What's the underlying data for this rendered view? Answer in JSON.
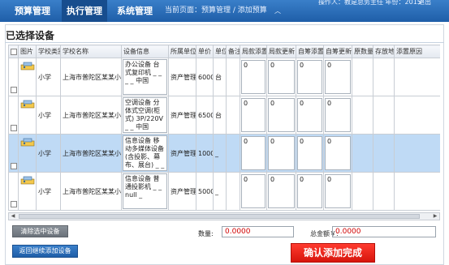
{
  "nav": {
    "items": [
      "预算管理",
      "执行管理",
      "系统管理"
    ],
    "breadcrumb": "当前页面：预算管理 / 添加预算",
    "collapse_icon": "chevron-up-icon",
    "user_info": "操作人：教是总务主任  年份：2015",
    "logout": "退出"
  },
  "page": {
    "title": "已选择设备"
  },
  "table": {
    "columns": [
      "",
      "图片",
      "学校类别",
      "学校名称",
      "设备信息",
      "所属单位",
      "单价",
      "单位",
      "备注",
      "局款添置",
      "局款更新",
      "自筹添置",
      "自筹更新",
      "原数量",
      "存放地",
      "添置原因"
    ],
    "rows": [
      {
        "selected": false,
        "school_type": "小学",
        "school_name": "上海市普陀区某某小学",
        "info": "办公设备 台式复印机 _ _ _ _ 中国",
        "unit_org": "资产管理",
        "price": "6000",
        "unit": "台",
        "note": "",
        "vals": [
          "0",
          "0",
          "0",
          "0"
        ]
      },
      {
        "selected": false,
        "school_type": "小学",
        "school_name": "上海市普陀区某某小学",
        "info": "空调设备 分体式空调(柜式) 3P/220V _ _ 中国",
        "unit_org": "资产管理",
        "price": "6500",
        "unit": "台",
        "note": "",
        "vals": [
          "0",
          "0",
          "0",
          "0"
        ]
      },
      {
        "selected": true,
        "school_type": "小学",
        "school_name": "上海市普陀区某某小学",
        "info": "信息设备 移动多媒体设备(含投影、幕布、展台) _ _ null _",
        "unit_org": "资产管理",
        "price": "1000",
        "unit": "_",
        "note": "",
        "vals": [
          "0",
          "0",
          "0",
          "0"
        ]
      },
      {
        "selected": false,
        "school_type": "小学",
        "school_name": "上海市普陀区某某小学",
        "info": "信息设备 普通投影机 _ _ null _",
        "unit_org": "资产管理",
        "price": "5000",
        "unit": "_",
        "note": "",
        "vals": [
          "0",
          "0",
          "0",
          "0"
        ]
      }
    ]
  },
  "footer": {
    "clear_button": "清除选中设备",
    "back_button": "返回继续添加设备",
    "qty_label": "数量:",
    "qty_value": "0.0000",
    "amount_label": "总金额￥:",
    "amount_value": "0.0000",
    "confirm_button": "确认添加完成"
  },
  "colors": {
    "nav_blue": "#1f5ea8",
    "selected_row": "#bfdaf5",
    "confirm_red": "#e0180e",
    "value_red": "#d00000"
  }
}
